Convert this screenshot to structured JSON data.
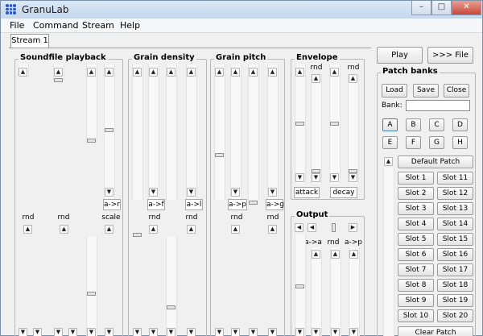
{
  "window": {
    "title": "GranuLab"
  },
  "menu": [
    "File",
    "Command",
    "Stream",
    "Help"
  ],
  "tabs": [
    "Stream 1"
  ],
  "groups": {
    "soundfile": {
      "title": "Soundfile playback",
      "labels": [
        "rnd",
        "rnd",
        "scale"
      ],
      "mode_button": "a->r"
    },
    "density": {
      "title": "Grain density",
      "labels": [
        "rnd",
        "rnd"
      ],
      "mode_buttons": [
        "a->f",
        "a->l"
      ]
    },
    "pitch": {
      "title": "Grain pitch",
      "labels": [
        "rnd",
        "rnd"
      ],
      "mode_buttons": [
        "a->p",
        "a->g"
      ]
    },
    "envelope": {
      "title": "Envelope",
      "labels": [
        "rnd",
        "rnd"
      ],
      "buttons": [
        "attack",
        "decay"
      ]
    },
    "output": {
      "title": "Output",
      "labels": [
        "a->a",
        "rnd",
        "a->p"
      ]
    }
  },
  "transport": {
    "play": "Play",
    "to_file": ">>> File"
  },
  "patch_banks": {
    "title": "Patch banks",
    "load": "Load",
    "save": "Save",
    "close": "Close",
    "bank_label": "Bank:",
    "bank_value": "",
    "banks": [
      "A",
      "B",
      "C",
      "D",
      "E",
      "F",
      "G",
      "H"
    ],
    "selected_bank": "A",
    "default_patch": "Default Patch",
    "slots": [
      "Slot 1",
      "Slot 11",
      "Slot 2",
      "Slot 12",
      "Slot 3",
      "Slot 13",
      "Slot 4",
      "Slot 14",
      "Slot 5",
      "Slot 15",
      "Slot 6",
      "Slot 16",
      "Slot 7",
      "Slot 17",
      "Slot 8",
      "Slot 18",
      "Slot 9",
      "Slot 19",
      "Slot 10",
      "Slot 20"
    ],
    "clear": "Clear Patch"
  },
  "colors": {
    "title_bar": "#c5d7ec",
    "close_button": "#c7473a",
    "window_bg": "#f0f0f0"
  }
}
